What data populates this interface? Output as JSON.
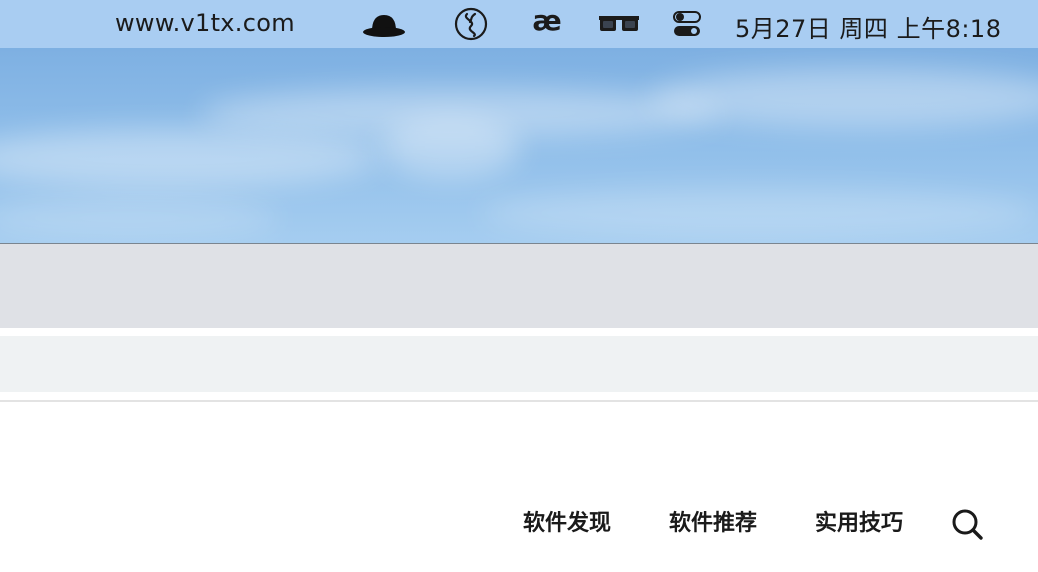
{
  "menubar": {
    "site": "www.v1tx.com",
    "ae_glyph": "æ",
    "clock": "5月27日 周四 上午8:18",
    "icons": [
      "bowler-hat-icon",
      "scroll-icon",
      "ae-icon",
      "glasses-icon",
      "control-center-icon"
    ]
  },
  "nav": {
    "items": [
      "软件发现",
      "软件推荐",
      "实用技巧"
    ],
    "search_icon": "search-icon"
  },
  "colors": {
    "menubar_bg": "#a9cdf2",
    "sky": "#8ebde9",
    "band1": "#dfe1e6",
    "band2": "#eff2f3"
  }
}
